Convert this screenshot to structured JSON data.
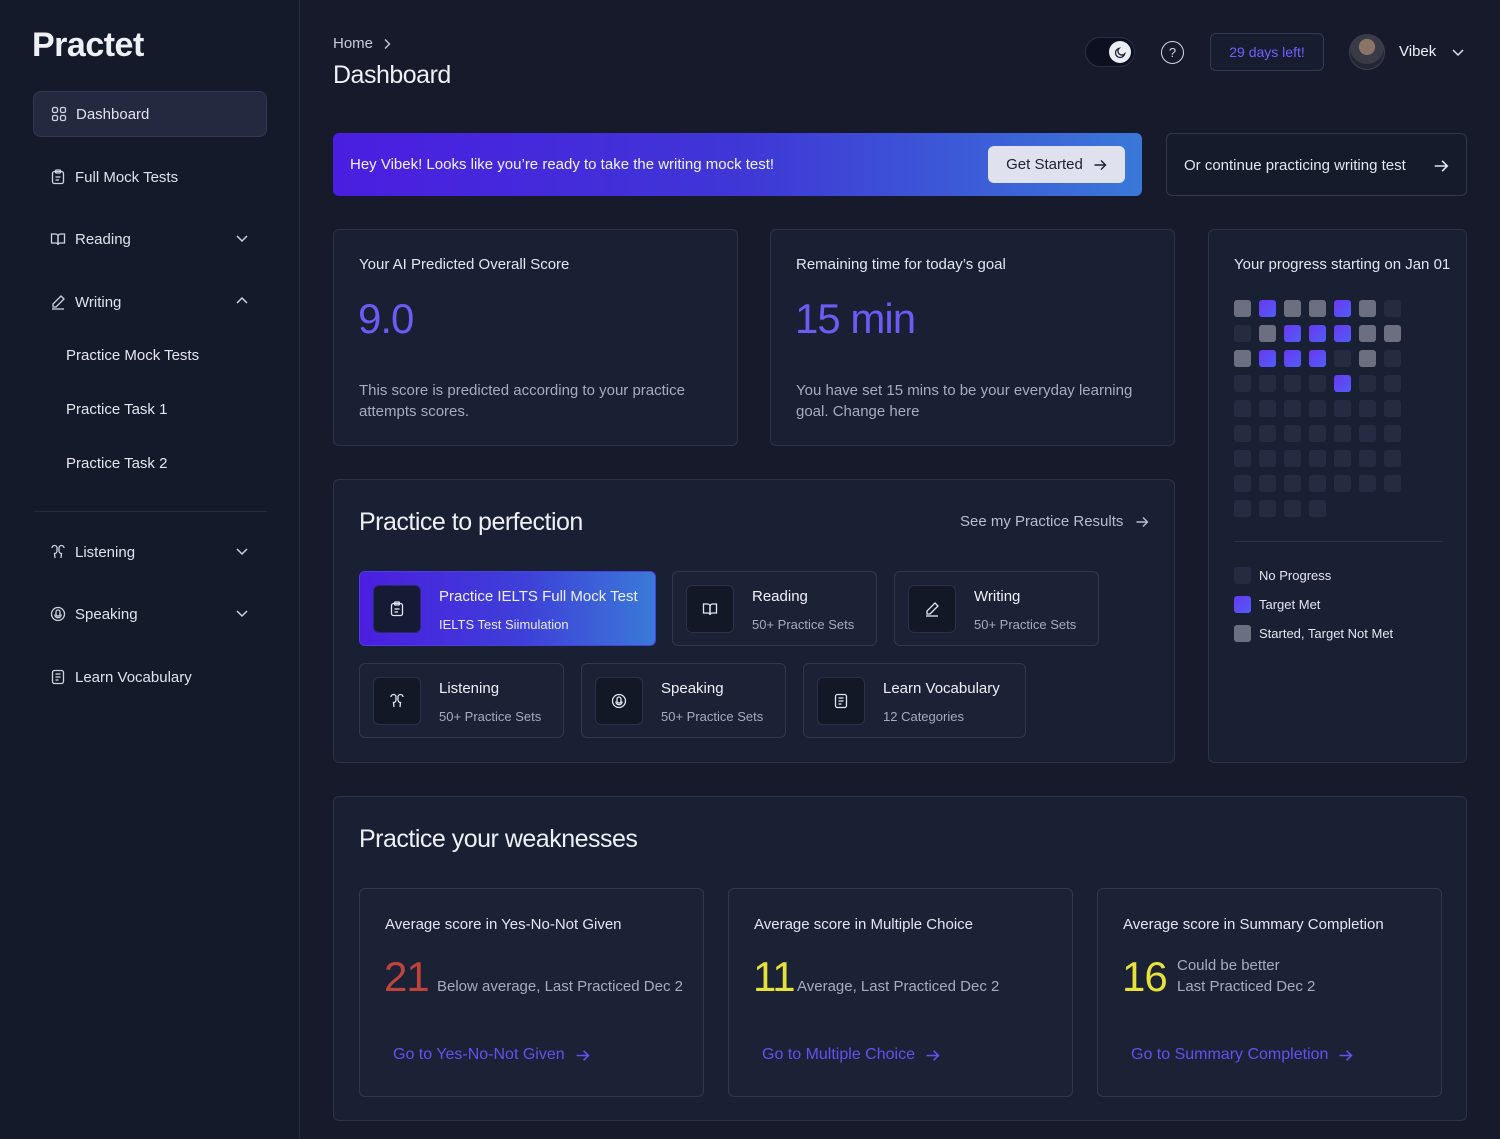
{
  "app": {
    "logo": "Practet"
  },
  "sidebar": {
    "items": [
      {
        "label": "Dashboard",
        "icon": "grid-icon"
      },
      {
        "label": "Full Mock Tests",
        "icon": "clipboard-icon"
      },
      {
        "label": "Reading",
        "icon": "book-icon"
      },
      {
        "label": "Writing",
        "icon": "pencil-icon"
      },
      {
        "label": "Listening",
        "icon": "earbuds-icon"
      },
      {
        "label": "Speaking",
        "icon": "microphone-icon"
      },
      {
        "label": "Learn Vocabulary",
        "icon": "notebook-icon"
      }
    ],
    "writing_sub": [
      "Practice Mock Tests",
      "Practice Task 1",
      "Practice Task 2"
    ]
  },
  "header": {
    "breadcrumb": "Home",
    "title": "Dashboard",
    "days_left": "29 days left!",
    "user_name": "Vibek"
  },
  "banner": {
    "text": "Hey Vibek! Looks like you’re ready to take the writing mock test!",
    "cta": "Get Started",
    "secondary": "Or continue practicing writing test"
  },
  "score_card": {
    "label": "Your AI Predicted Overall Score",
    "value": "9.0",
    "desc": "This score is predicted according to your practice attempts scores."
  },
  "goal_card": {
    "label": "Remaining time for today’s goal",
    "value": "15 min",
    "desc": "You have set 15 mins to be your everyday learning goal. Change here"
  },
  "progress": {
    "title": "Your progress starting on Jan 01",
    "grid": [
      "s",
      "t",
      "s",
      "s",
      "t",
      "s",
      "n",
      "n",
      "s",
      "t",
      "t",
      "t",
      "s",
      "s",
      "s",
      "t",
      "t",
      "t",
      "n",
      "s",
      "n",
      "n",
      "n",
      "n",
      "n",
      "t",
      "n",
      "n",
      "n",
      "n",
      "n",
      "n",
      "n",
      "n",
      "n",
      "n",
      "n",
      "n",
      "n",
      "n",
      "n",
      "n",
      "n",
      "n",
      "n",
      "n",
      "n",
      "n",
      "n",
      "n",
      "n",
      "n",
      "n",
      "n",
      "n",
      "n",
      "n",
      "n",
      "n",
      "n",
      "h",
      "h",
      "h"
    ],
    "legend": [
      {
        "label": "No Progress",
        "color": "#252b40"
      },
      {
        "label": "Target Met",
        "color": "#5b4cf3"
      },
      {
        "label": "Started, Target Not Met",
        "color": "#6b6f80"
      }
    ]
  },
  "practice": {
    "title": "Practice to perfection",
    "see_results": "See my Practice Results",
    "tiles": [
      {
        "title": "Practice IELTS Full Mock Test",
        "sub": "IELTS Test Siimulation",
        "icon": "clipboard-icon"
      },
      {
        "title": "Reading",
        "sub": "50+ Practice Sets",
        "icon": "book-icon"
      },
      {
        "title": "Writing",
        "sub": "50+ Practice Sets",
        "icon": "pencil-icon"
      },
      {
        "title": "Listening",
        "sub": "50+ Practice Sets",
        "icon": "earbuds-icon"
      },
      {
        "title": "Speaking",
        "sub": "50+ Practice Sets",
        "icon": "microphone-icon"
      },
      {
        "title": "Learn Vocabulary",
        "sub": "12 Categories",
        "icon": "notebook-icon"
      }
    ]
  },
  "weaknesses": {
    "title": "Practice your weaknesses",
    "cards": [
      {
        "label": "Average score in Yes-No-Not Given",
        "value": "21",
        "desc1": "Below average, Last Practiced Dec 2",
        "desc2": "",
        "link": "Go to Yes-No-Not Given",
        "color": "#c0443c"
      },
      {
        "label": "Average score in Multiple Choice",
        "value": "11",
        "desc1": "Average, Last Practiced Dec 2",
        "desc2": "",
        "link": "Go to Multiple Choice",
        "color": "#e6e23a"
      },
      {
        "label": "Average score in Summary Completion",
        "value": "16",
        "desc1": "Could be better",
        "desc2": "Last Practiced Dec 2",
        "link": "Go to Summary Completion",
        "color": "#e6e23a"
      }
    ]
  },
  "colors": {
    "accent": "#6a5cf4",
    "link": "#5f53f0",
    "background": "#161a2b"
  }
}
